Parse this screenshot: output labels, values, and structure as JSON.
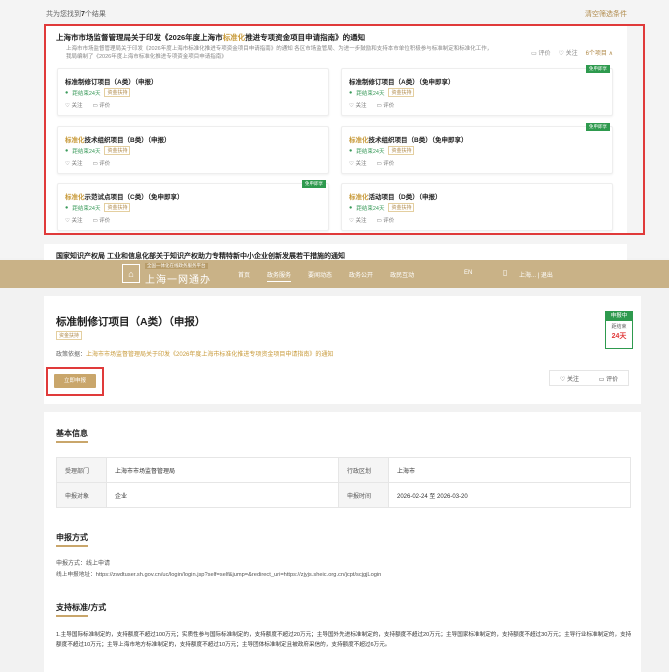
{
  "results": {
    "prefix": "共为您找到",
    "count": "7",
    "suffix": "个结果",
    "clear": "清空筛选条件"
  },
  "policy": {
    "title_a": "上海市市场监督管理局关于印发《2026年度上海市",
    "title_hl": "标准化",
    "title_b": "推进专项资金项目申请指南》的通知",
    "desc": "上海市市场监督管理局关于印发《2026年度上海市标准化推进专项资金项目申请指南》的通知 各区市场监管局、为进一步鼓励和支持本市单位积极参与标准制定和标准化工作，我局编制了《2026年度上海市标准化推进专项资金项目申请指南》",
    "eval": "评价",
    "follow": "关注",
    "count": "6个项目 ∧"
  },
  "projects": [
    {
      "hl": "",
      "name": "标准制修订项目（A类）（申报）",
      "status": "距结束24天",
      "tag": "资金扶持",
      "follow": "关注",
      "eval": "评价",
      "free": ""
    },
    {
      "hl": "",
      "name": "标准制修订项目（A类）（免申即享）",
      "status": "距结束24天",
      "tag": "资金扶持",
      "follow": "关注",
      "eval": "评价",
      "free": "免申即享"
    },
    {
      "hl": "标准化",
      "name": "技术组织项目（B类）（申报）",
      "status": "距结束24天",
      "tag": "资金扶持",
      "follow": "关注",
      "eval": "评价",
      "free": ""
    },
    {
      "hl": "标准化",
      "name": "技术组织项目（B类）（免申即享）",
      "status": "距结束24天",
      "tag": "资金扶持",
      "follow": "关注",
      "eval": "评价",
      "free": "免申即享"
    },
    {
      "hl": "标准化",
      "name": "示范试点项目（C类）（免申即享）",
      "status": "距结束24天",
      "tag": "资金扶持",
      "follow": "关注",
      "eval": "评价",
      "free": "免申即享"
    },
    {
      "hl": "标准化",
      "name": "活动项目（D类）（申报）",
      "status": "距结束24天",
      "tag": "资金扶持",
      "follow": "关注",
      "eval": "评价",
      "free": ""
    }
  ],
  "next_title": "国家知识产权局 工业和信息化部关于知识产权助力专精特新中小企业创新发展若干措施的通知",
  "nav": {
    "logo_sub": "全国一体化在线政务服务平台",
    "logo_main": "上海一网通办",
    "items": [
      "首页",
      "政务服务",
      "要闻动态",
      "政务公开",
      "政民互动"
    ],
    "en": "EN",
    "user": "上海... | 退出"
  },
  "detail": {
    "title": "标准制修订项目（A类）（申报）",
    "tag": "资金扶持",
    "basis_label": "政策依据：",
    "basis_link": "上海市市场监督管理局关于印发《2026年度上海市标准化推进专项资金项目申请指南》的通知",
    "apply": "立即申报",
    "badge_status": "申报中",
    "badge_label": "距结束",
    "badge_days": "24天",
    "follow": "关注",
    "eval": "评价"
  },
  "basic": {
    "heading": "基本信息",
    "rows": [
      {
        "k1": "受理部门",
        "v1": "上海市市场监督管理局",
        "k2": "行政区划",
        "v2": "上海市"
      },
      {
        "k1": "申报对象",
        "v1": "企业",
        "k2": "申报时间",
        "v2": "2026-02-24 至 2026-03-20"
      }
    ]
  },
  "method": {
    "heading": "申报方式",
    "line1": "申报方式：线上申请",
    "line2": "线上申报地址：https://zwdtuser.sh.gov.cn/uc/login/login.jsp?self=self&jump=&redirect_uri=https://zjyjs.sheic.org.cn/jcpt/scjgjLogin"
  },
  "standard": {
    "heading": "支持标准/方式",
    "text": "1.主导国际标准制定的，支持额度不超过100万元；实质性参与国际标准制定的，支持额度不超过20万元；主导国外先进标准制定的，支持额度不超过20万元；主导国家标准制定的，支持额度不超过30万元；主导行业标准制定的，支持额度不超过10万元；主导上海市地方标准制定的，支持额度不超过10万元；主导团体标准制定且被政府采信的，支持额度不超过6万元。"
  }
}
